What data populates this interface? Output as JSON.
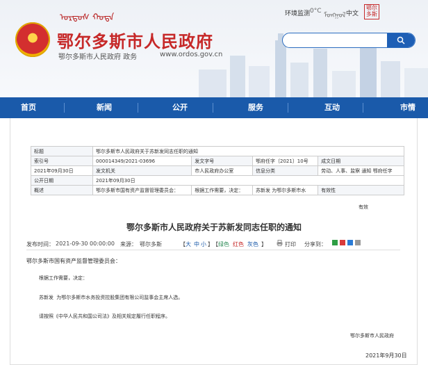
{
  "header": {
    "mongol_text": "ᠣᠷᠳᠣᠰ ᠬᠣᠲᠠ",
    "site_title": "鄂尔多斯市人民政府",
    "site_sub": "鄂尔多斯市人民政府 政务",
    "url": "www.ordos.gov.cn",
    "env_monitor": "环境监测",
    "weather": "0°C",
    "top_mongol": "ᠮᠣᠩᠭᠣᠯ",
    "lang_zh": "中文",
    "seal_text": "鄂尔多斯",
    "search_placeholder": ""
  },
  "nav": {
    "items": [
      "首页",
      "新闻",
      "公开",
      "服务",
      "互动",
      "市情"
    ]
  },
  "meta": {
    "title_label": "标题",
    "title_value": "鄂尔多斯市人民政府关于苏新发同志任职的通知",
    "index_label": "索引号",
    "index_value": "000014349/2021-03696",
    "doc_no_label": "发文字号",
    "doc_no_value": "鄂府任字〔2021〕10号",
    "date_label": "成文日期",
    "date_value": "2021年09月30日",
    "issuer_label": "发文机关",
    "issuer_value": "市人民政府办公室",
    "category_label": "信息分类",
    "category_value": "劳动、人事、监察  通知  鄂府任字",
    "publish_label": "公开日期",
    "publish_value": "2021年09月30日",
    "summary_label": "概述",
    "summary_value": "鄂尔多斯市国有资产监督管理委员会：",
    "summary_value2": "根据工作需要，决定：",
    "summary_value3": "苏新发 为鄂尔多斯市水",
    "validity_label": "有效性",
    "validity_value": "有效"
  },
  "article": {
    "title": "鄂尔多斯市人民政府关于苏新发同志任职的通知",
    "publish_time_label": "发布时间：",
    "publish_time": "2021-09-30 00:00:00",
    "source_label": "来源：",
    "source": "鄂尔多斯",
    "font_large": "大",
    "font_medium": "中",
    "font_small": "小",
    "color_green": "绿色",
    "color_red": "红色",
    "color_gray": "灰色",
    "print_label": "打印",
    "share_label": "分享到：",
    "recipient": "鄂尔多斯市国有资产监督管理委员会：",
    "para1": "根据工作需要，决定：",
    "para2": "苏新发 为鄂尔多斯市水务投资控股集团有限公司监事会主席人选。",
    "para3": "请按照《中华人民共和国公司法》及相关规定履行任职程序。",
    "signature": "鄂尔多斯市人民政府",
    "sign_date": "2021年9月30日"
  },
  "colors": {
    "brand_red": "#c62828",
    "nav_blue": "#1a5aaa"
  }
}
